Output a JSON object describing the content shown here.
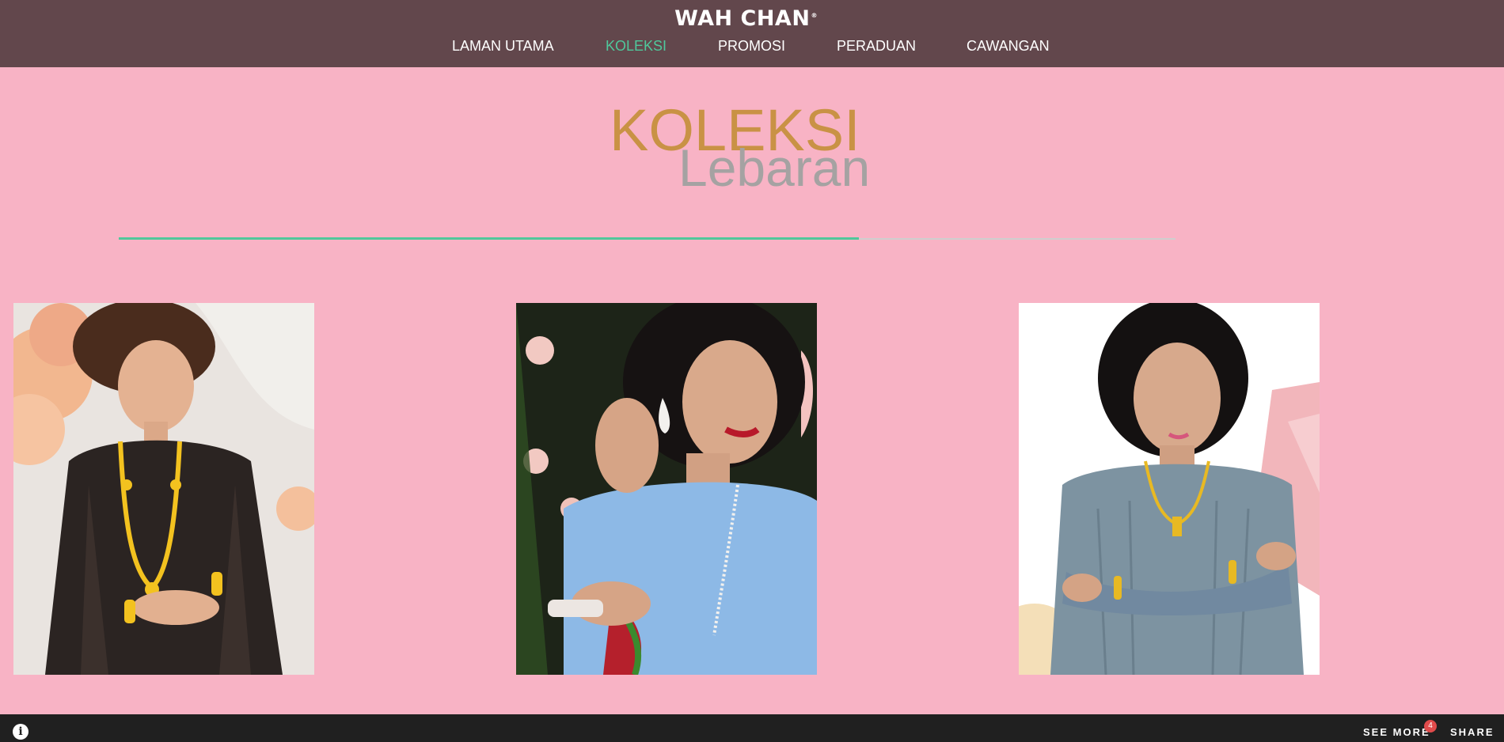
{
  "header": {
    "brand": "WAH CHAN",
    "brand_mark": "®",
    "nav": [
      {
        "label": "LAMAN UTAMA",
        "active": false
      },
      {
        "label": "KOLEKSI",
        "active": true
      },
      {
        "label": "PROMOSI",
        "active": false
      },
      {
        "label": "PERADUAN",
        "active": false
      },
      {
        "label": "CAWANGAN",
        "active": false
      }
    ]
  },
  "hero": {
    "title": "KOLEKSI",
    "subtitle": "Lebaran"
  },
  "progress": {
    "fraction": 0.7
  },
  "gallery": {
    "items": [
      {
        "icon": "model-black-lace-gold-necklace"
      },
      {
        "icon": "model-blue-dress-diamond-earring"
      },
      {
        "icon": "model-grey-lace-gold-necklace"
      }
    ]
  },
  "footer": {
    "info_icon": "i",
    "see_more": "SEE MORE",
    "badge_count": "4",
    "share": "SHARE"
  },
  "colors": {
    "page_bg": "#f8b3c5",
    "header_bg": "#62474c",
    "accent": "#4fc89b",
    "title_gold": "#c99245",
    "subtitle_grey": "#a5a2a2",
    "footer_bg": "#202020",
    "badge": "#e04b4b"
  }
}
